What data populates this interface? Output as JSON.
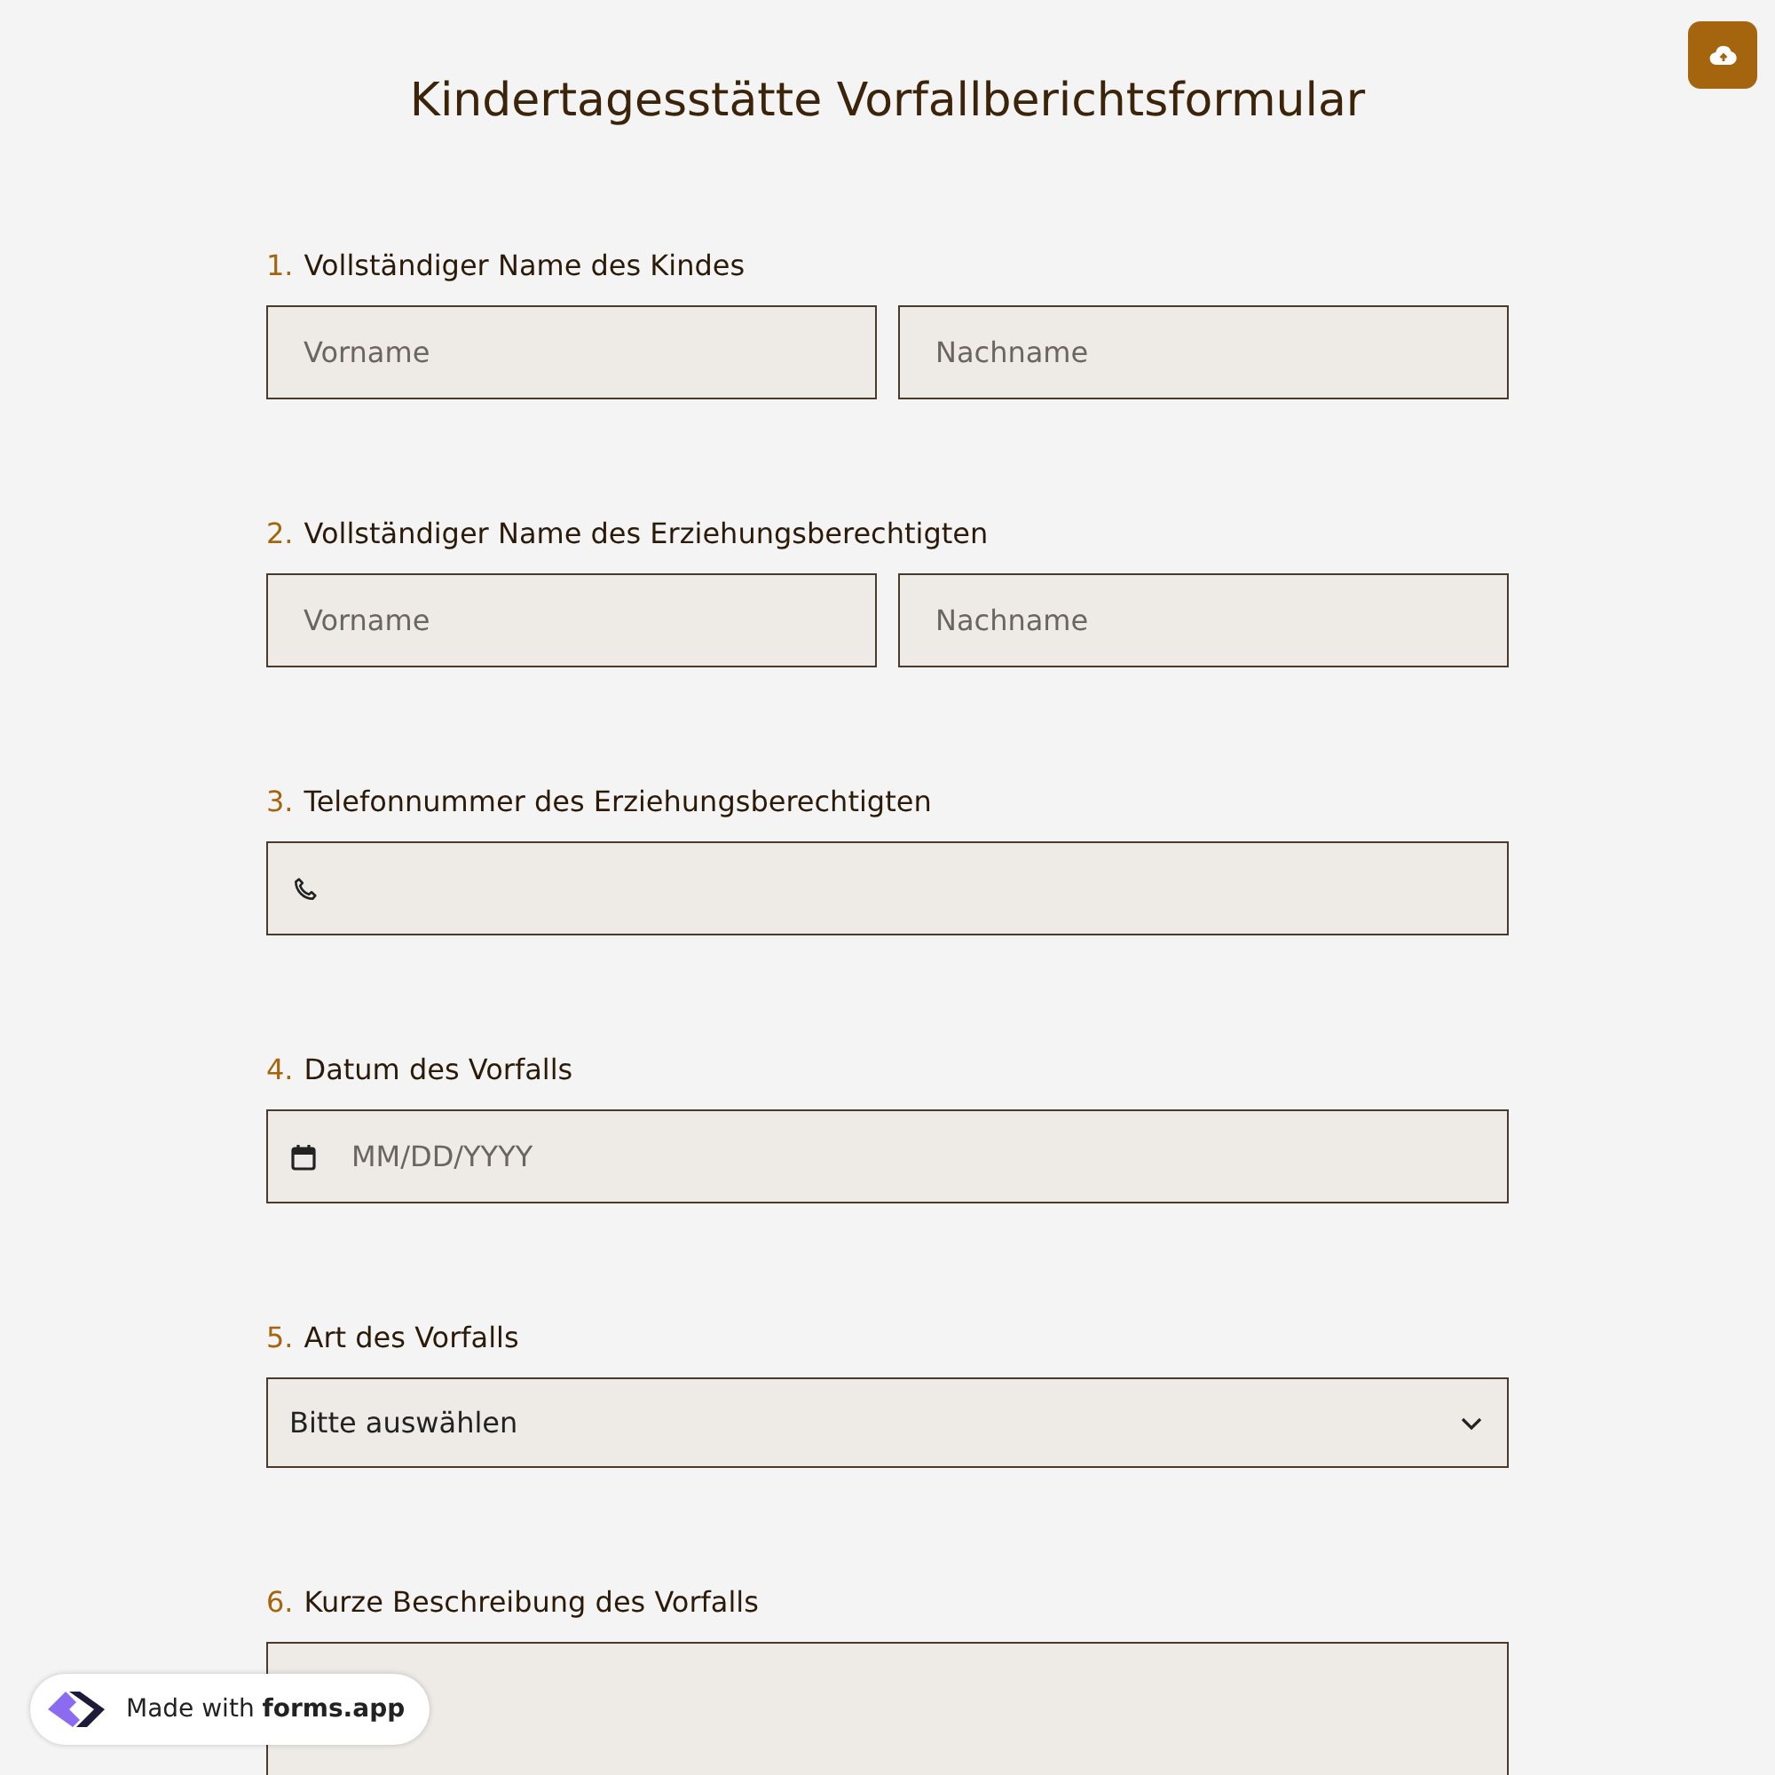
{
  "title": "Kindertagesstätte Vorfallberichtsformular",
  "questions": [
    {
      "number": "1.",
      "label": "Vollständiger Name des Kindes",
      "kind": "name",
      "fields": [
        {
          "placeholder": "Vorname"
        },
        {
          "placeholder": "Nachname"
        }
      ]
    },
    {
      "number": "2.",
      "label": "Vollständiger Name des Erziehungsberechtigten",
      "kind": "name",
      "fields": [
        {
          "placeholder": "Vorname"
        },
        {
          "placeholder": "Nachname"
        }
      ]
    },
    {
      "number": "3.",
      "label": "Telefonnummer des Erziehungsberechtigten",
      "kind": "phone"
    },
    {
      "number": "4.",
      "label": "Datum des Vorfalls",
      "kind": "date",
      "placeholder": "MM/DD/YYYY"
    },
    {
      "number": "5.",
      "label": "Art des Vorfalls",
      "kind": "select",
      "value": "Bitte auswählen"
    },
    {
      "number": "6.",
      "label": "Kurze Beschreibung des Vorfalls",
      "kind": "textarea"
    }
  ],
  "badge": {
    "text": "Made with **forms.app**"
  }
}
